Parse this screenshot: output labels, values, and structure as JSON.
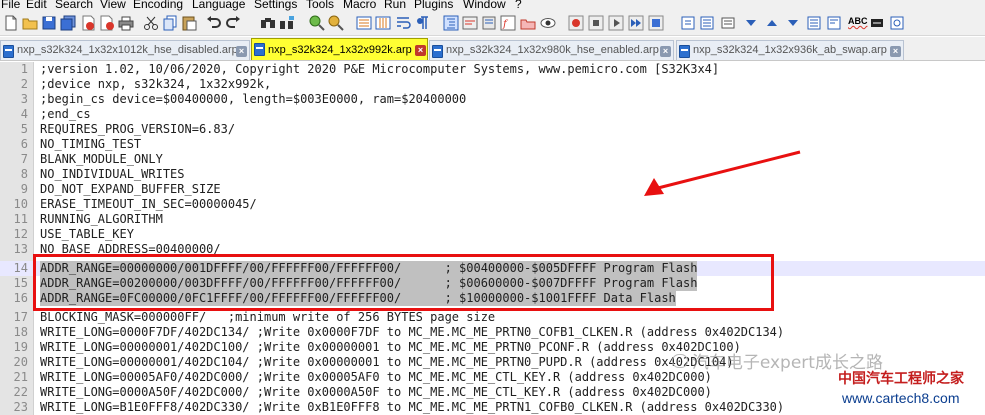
{
  "menu": [
    "File",
    "Edit",
    "Search",
    "View",
    "Encoding",
    "Language",
    "Settings",
    "Tools",
    "Macro",
    "Run",
    "Plugins",
    "Window",
    "?"
  ],
  "toolbar_icons": [
    "new-file-icon",
    "open-file-icon",
    "save-icon",
    "save-all-icon",
    "close-icon",
    "close-all-icon",
    "print-icon",
    "cut-icon",
    "copy-icon",
    "paste-icon",
    "undo-icon",
    "redo-icon",
    "find-icon",
    "replace-icon",
    "zoom-in-icon",
    "zoom-out-icon",
    "sync-vertical-icon",
    "sync-horizontal-icon",
    "word-wrap-icon",
    "show-all-chars-icon",
    "indent-guide-icon",
    "language-icon",
    "doc-map-icon",
    "function-list-icon",
    "folder-workspace-icon",
    "monitoring-icon",
    "record-macro-icon",
    "stop-macro-icon",
    "play-macro-icon",
    "run-macro-multiple-icon",
    "save-macro-icon",
    "plugin-a-icon",
    "plugin-b-icon",
    "plugin-c-icon",
    "plugin-d-icon",
    "plugin-e-icon",
    "plugin-f-icon",
    "plugin-g-icon",
    "spellcheck-icon",
    "plugin-h-icon",
    "plugin-i-icon"
  ],
  "spellcheck_label": "ABC",
  "tabs": [
    {
      "label": "nxp_s32k324_1x32x1012k_hse_disabled.arp",
      "active": false
    },
    {
      "label": "nxp_s32k324_1x32x992k.arp",
      "active": true
    },
    {
      "label": "nxp_s32k324_1x32x980k_hse_enabled.arp",
      "active": false
    },
    {
      "label": "nxp_s32k324_1x32x936k_ab_swap.arp",
      "active": false
    }
  ],
  "editor": {
    "lines": [
      {
        "n": "1",
        "text": ";version 1.02, 10/06/2020, Copyright 2020 P&E Microcomputer Systems, www.pemicro.com [S32K3x4]"
      },
      {
        "n": "2",
        "text": ";device nxp, s32k324, 1x32x992k,"
      },
      {
        "n": "3",
        "text": ";begin_cs device=$00400000, length=$003E0000, ram=$20400000"
      },
      {
        "n": "4",
        "text": ";end_cs"
      },
      {
        "n": "5",
        "text": "REQUIRES_PROG_VERSION=6.83/"
      },
      {
        "n": "6",
        "text": "NO_TIMING_TEST"
      },
      {
        "n": "7",
        "text": "BLANK_MODULE_ONLY"
      },
      {
        "n": "8",
        "text": "NO_INDIVIDUAL_WRITES"
      },
      {
        "n": "9",
        "text": "DO_NOT_EXPAND_BUFFER_SIZE"
      },
      {
        "n": "10",
        "text": "ERASE_TIMEOUT_IN_SEC=00000045/"
      },
      {
        "n": "11",
        "text": "RUNNING_ALGORITHM"
      },
      {
        "n": "12",
        "text": "USE_TABLE_KEY"
      },
      {
        "n": "13",
        "text": "NO_BASE_ADDRESS=00400000/"
      },
      {
        "n": "14",
        "text": "ADDR_RANGE=00000000/001DFFFF/00/FFFFFF00/FFFFFF00/      ; $00400000-$005DFFFF Program Flash"
      },
      {
        "n": "15",
        "text": "ADDR_RANGE=00200000/003DFFFF/00/FFFFFF00/FFFFFF00/      ; $00600000-$007DFFFF Program Flash"
      },
      {
        "n": "16",
        "text": "ADDR_RANGE=0FC00000/0FC1FFFF/00/FFFFFF00/FFFFFF00/      ; $10000000-$1001FFFF Data Flash"
      },
      {
        "n": "17",
        "text": "BLOCKING_MASK=000000FF/   ;minimum write of 256 BYTES page size"
      },
      {
        "n": "18",
        "text": "WRITE_LONG=0000F7DF/402DC134/ ;Write 0x0000F7DF to MC_ME.MC_ME_PRTN0_COFB1_CLKEN.R (address 0x402DC134)"
      },
      {
        "n": "19",
        "text": "WRITE_LONG=00000001/402DC100/ ;Write 0x00000001 to MC_ME.MC_ME_PRTN0_PCONF.R (address 0x402DC100)"
      },
      {
        "n": "20",
        "text": "WRITE_LONG=00000001/402DC104/ ;Write 0x00000001 to MC_ME.MC_ME_PRTN0_PUPD.R (address 0x402DC104)"
      },
      {
        "n": "21",
        "text": "WRITE_LONG=00005AF0/402DC000/ ;Write 0x00005AF0 to MC_ME.MC_ME_CTL_KEY.R (address 0x402DC000)"
      },
      {
        "n": "22",
        "text": "WRITE_LONG=0000A50F/402DC000/ ;Write 0x0000A50F to MC_ME.MC_ME_CTL_KEY.R (address 0x402DC000)"
      },
      {
        "n": "23",
        "text": "WRITE_LONG=B1E0FFF8/402DC330/ ;Write 0xB1E0FFF8 to MC_ME.MC_ME_PRTN1_COFB0_CLKEN.R (address 0x402DC330)"
      }
    ]
  },
  "watermark": {
    "wechat_text": "汽车电子expert成长之路",
    "logo_text": "中国汽车工程师之家",
    "url": "www.cartech8.com"
  },
  "colors": {
    "active_tab": "#ffff33",
    "highlight_box": "#e81010",
    "arrow": "#e81010",
    "selection": "#c0c0c0",
    "gutter": "#e4e4e4"
  }
}
